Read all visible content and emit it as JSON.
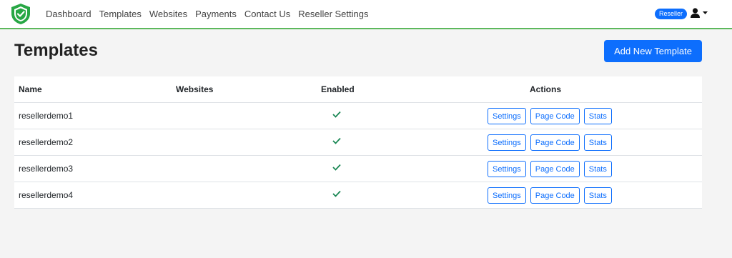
{
  "nav": {
    "links": [
      "Dashboard",
      "Templates",
      "Websites",
      "Payments",
      "Contact Us",
      "Reseller Settings"
    ],
    "badge": "Reseller"
  },
  "page": {
    "title": "Templates",
    "add_button": "Add New Template"
  },
  "table": {
    "headers": [
      "Name",
      "Websites",
      "Enabled",
      "Actions"
    ],
    "rows": [
      {
        "name": "resellerdemo1",
        "websites": "",
        "enabled": true
      },
      {
        "name": "resellerdemo2",
        "websites": "",
        "enabled": true
      },
      {
        "name": "resellerdemo3",
        "websites": "",
        "enabled": true
      },
      {
        "name": "resellerdemo4",
        "websites": "",
        "enabled": true
      }
    ],
    "actions": [
      "Settings",
      "Page Code",
      "Stats"
    ]
  },
  "colors": {
    "primary": "#0d6efd",
    "navbar_border": "#5cb85c",
    "check": "#198754",
    "logo": "#28a745"
  },
  "icons": {
    "logo": "shield-check-icon",
    "user": "user-icon",
    "caret": "caret-down-icon",
    "enabled": "check-icon"
  }
}
